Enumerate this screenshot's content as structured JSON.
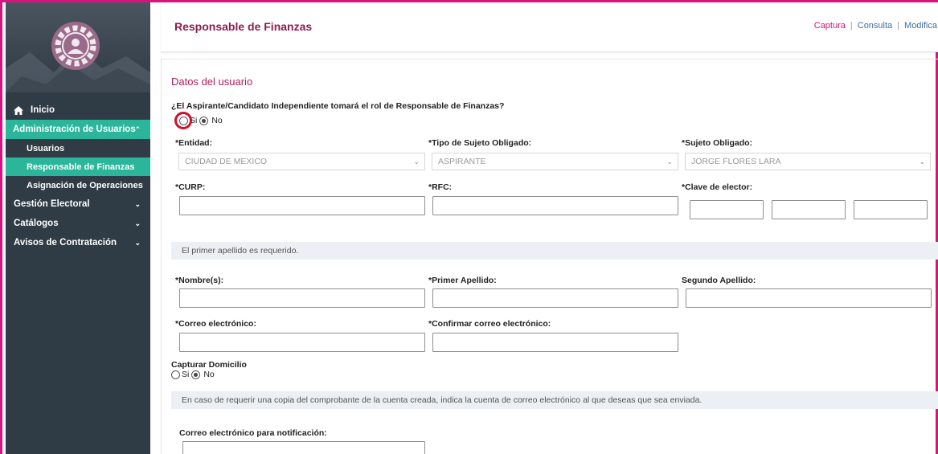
{
  "header": {
    "title": "Responsable de Finanzas",
    "links": [
      "Captura",
      "Consulta",
      "Modifica"
    ]
  },
  "sidebar": {
    "items": [
      {
        "label": "Inicio",
        "icon": "home-icon"
      },
      {
        "label": "Administración de Usuarios",
        "icon": "chevron-up-icon"
      },
      {
        "label": "Usuarios"
      },
      {
        "label": "Responsable de Finanzas"
      },
      {
        "label": "Asignación de Operaciones"
      },
      {
        "label": "Gestión Electoral",
        "icon": "chevron-down-icon"
      },
      {
        "label": "Catálogos",
        "icon": "chevron-down-icon"
      },
      {
        "label": "Avisos de Contratación",
        "icon": "chevron-down-icon"
      }
    ]
  },
  "form": {
    "section_title": "Datos del usuario",
    "question": "¿El Aspirante/Candidato Independiente tomará el rol de Responsable de Finanzas?",
    "opt_si": "Si",
    "opt_no": "No",
    "entidad_label": "*Entidad:",
    "entidad_value": "CIUDAD DE MEXICO",
    "tipo_label": "*Tipo de Sujeto Obligado:",
    "tipo_value": "ASPIRANTE",
    "sujeto_label": "*Sujeto Obligado:",
    "sujeto_value": "JORGE FLORES LARA",
    "curp_label": "*CURP:",
    "rfc_label": "*RFC:",
    "clave_label": "*Clave de elector:",
    "notice_apellido": "El primer apellido es requerido.",
    "nombre_label": "*Nombre(s):",
    "primer_label": "*Primer Apellido:",
    "segundo_label": "Segundo Apellido:",
    "correo_label": "*Correo electrónico:",
    "confirmar_label": "*Confirmar correo electrónico:",
    "domicilio_label": "Capturar Domicilio",
    "notice_copia": "En caso de requerir una copia del comprobante de la cuenta creada, indica la cuenta de correo electrónico al que deseas que sea enviada.",
    "notif_label": "Correo electrónico para notificación:"
  },
  "colors": {
    "accent": "#d5147e",
    "sidebar_bg": "#2f3b45",
    "sidebar_active": "#2bb59a",
    "title": "#8a1c4f"
  }
}
